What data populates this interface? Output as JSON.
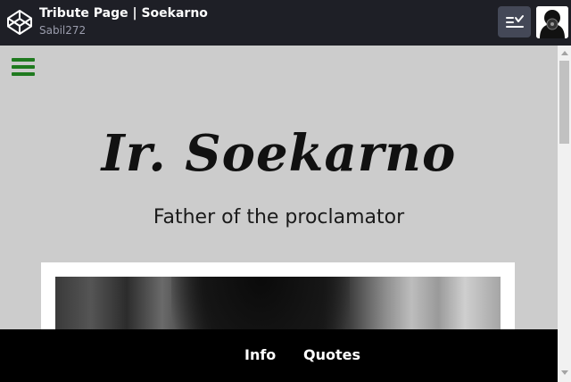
{
  "codepen_header": {
    "pen_title": "Tribute Page | Soekarno",
    "author": "Sabil272",
    "icons": {
      "logo": "codepen-logo-icon",
      "change_view": "change-view-icon",
      "avatar": "user-avatar-icon"
    }
  },
  "preview": {
    "menu_icon": "hamburger-menu-icon",
    "title": "Ir. Soekarno",
    "subtitle": "Father of the proclamator",
    "image_description": "black-and-white portrait photo",
    "nav": {
      "info": "Info",
      "quotes": "Quotes"
    }
  },
  "colors": {
    "header_bg": "#1e1f26",
    "page_bg": "#cccccc",
    "nav_bg": "#000000",
    "menu_icon": "#1f7a1f"
  }
}
